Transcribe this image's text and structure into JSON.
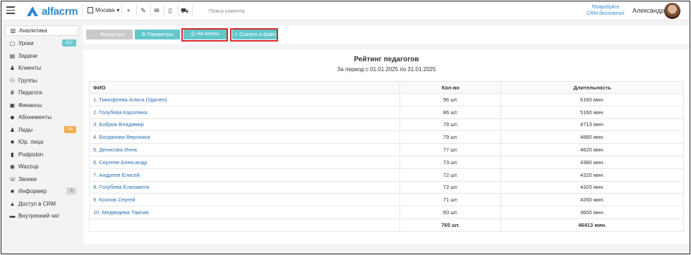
{
  "app": {
    "logo_text": "alfacrm",
    "city": "Москва",
    "search_placeholder": "Поиск клиента",
    "try_line1": "Попробуйте",
    "try_line2": "CRM бесплатно!",
    "user_name": "Александра"
  },
  "icons": {
    "menu": "≡",
    "city_caret": "▾",
    "add": "+",
    "wrench": "✎",
    "mail": "✉",
    "phone": "▯",
    "cart": "⛟"
  },
  "sidebar": {
    "items": [
      {
        "label": "Аналитика",
        "icon": "▥",
        "badge": ""
      },
      {
        "label": "Уроки",
        "icon": "▢",
        "badge": "112"
      },
      {
        "label": "Задачи",
        "icon": "▤",
        "badge": ""
      },
      {
        "label": "Клиенты",
        "icon": "♟",
        "badge": ""
      },
      {
        "label": "Группы",
        "icon": "⚇",
        "badge": ""
      },
      {
        "label": "Педагоги",
        "icon": "♛",
        "badge": ""
      },
      {
        "label": "Финансы",
        "icon": "▣",
        "badge": ""
      },
      {
        "label": "Абонементы",
        "icon": "◆",
        "badge": ""
      },
      {
        "label": "Лиды",
        "icon": "♟",
        "badge": "26"
      },
      {
        "label": "Юр. лица",
        "icon": "■",
        "badge": ""
      },
      {
        "label": "Podpislon",
        "icon": "▮",
        "badge": ""
      },
      {
        "label": "Wazzup",
        "icon": "◉",
        "badge": ""
      },
      {
        "label": "Звонки",
        "icon": "☏",
        "badge": ""
      },
      {
        "label": "Информер",
        "icon": "■",
        "badge": "3"
      },
      {
        "label": "Доступ в CRM",
        "icon": "▲",
        "badge": ""
      },
      {
        "label": "Внутренний чат",
        "icon": "▬",
        "badge": ""
      }
    ]
  },
  "toolbar": {
    "back_label": "← Вернуться",
    "params_label": "⚙ Параметры",
    "print_label": "⎙ На печать",
    "download_label": "⇩ Скачать в файл"
  },
  "report": {
    "title": "Рейтинг педагогов",
    "period": "За период с 01.01.2025 по 31.01.2025",
    "columns": [
      "ФИО",
      "Кол-во",
      "Длительность"
    ],
    "rows": [
      {
        "name": "1. Тимофеева Алиса (Удален)",
        "count": "96 шт.",
        "duration": "6160 мин."
      },
      {
        "name": "2. Голубева Каролина",
        "count": "86 шт.",
        "duration": "5160 мин."
      },
      {
        "name": "3. Бобров Владимир",
        "count": "79 шт.",
        "duration": "4713 мин."
      },
      {
        "name": "4. Богданова Вероника",
        "count": "79 шт.",
        "duration": "4880 мин."
      },
      {
        "name": "5. Денисова Инна",
        "count": "77 шт.",
        "duration": "4620 мин."
      },
      {
        "name": "6. Сергеев Александр",
        "count": "73 шт.",
        "duration": "4380 мин."
      },
      {
        "name": "7. Андреев Елисей",
        "count": "72 шт.",
        "duration": "4320 мин."
      },
      {
        "name": "8. Голубева Елизавета",
        "count": "72 шт.",
        "duration": "4320 мин."
      },
      {
        "name": "9. Козлов Сергей",
        "count": "71 шт.",
        "duration": "4260 мин."
      },
      {
        "name": "10. Медведева Таисия",
        "count": "60 шт.",
        "duration": "3600 мин."
      }
    ],
    "total_count": "765 шт.",
    "total_duration": "46413 мин."
  },
  "colors": {
    "accent": "#2d8ad0",
    "teal": "#62c7cb",
    "highlight": "#d9262c",
    "link": "#2a6fb0"
  }
}
